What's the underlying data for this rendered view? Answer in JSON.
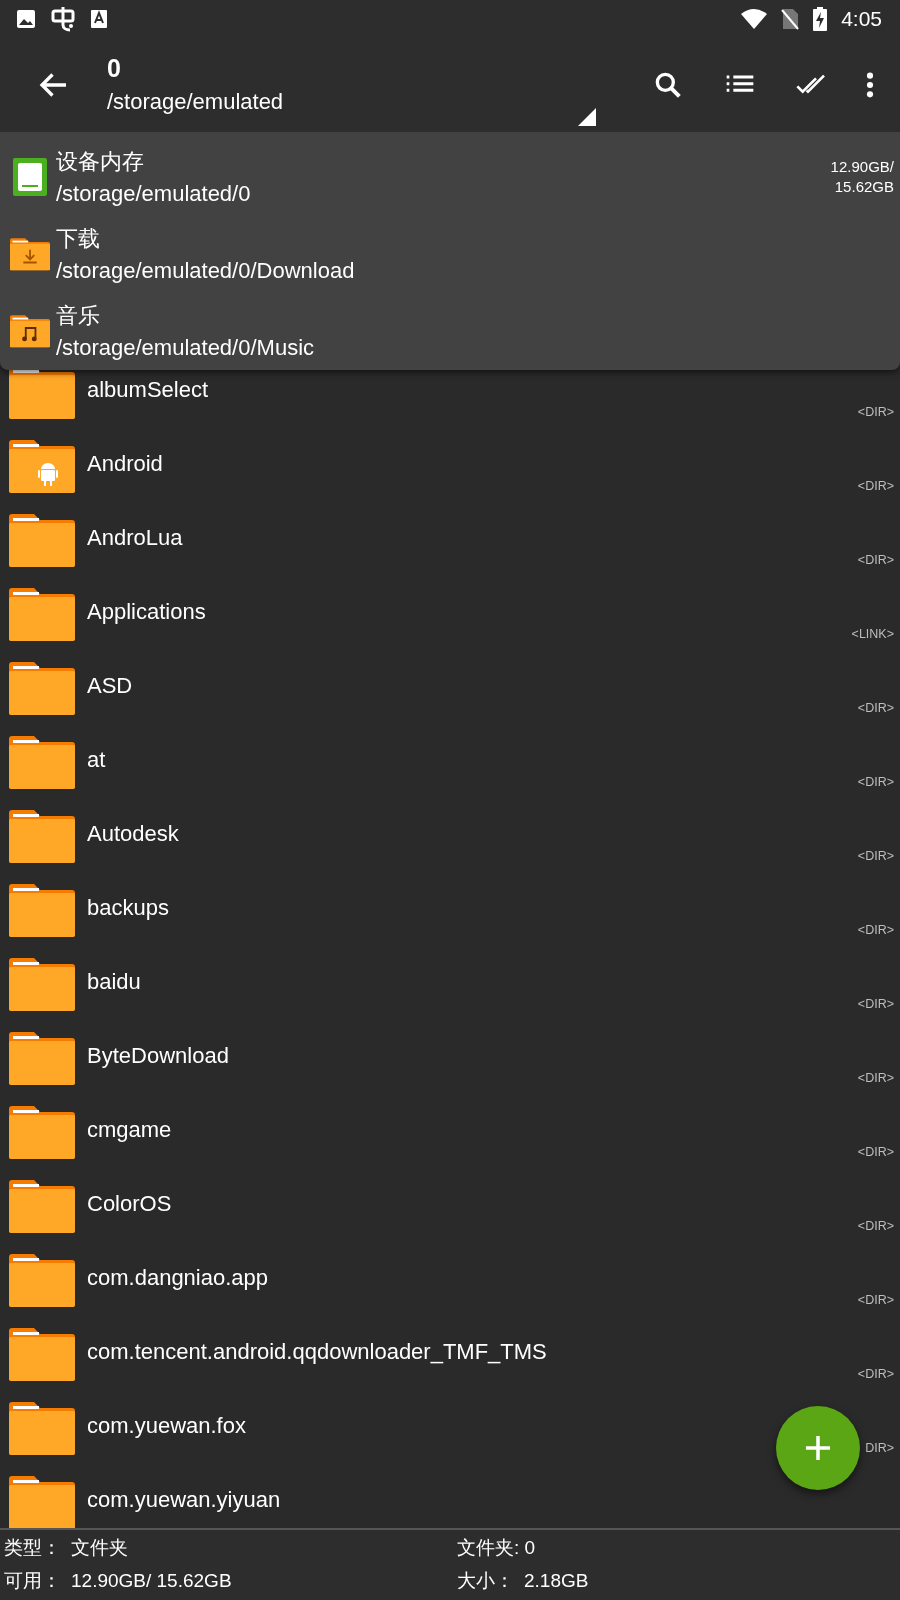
{
  "status_bar": {
    "time": "4:05"
  },
  "toolbar": {
    "title": "0",
    "path": "/storage/emulated"
  },
  "storage_menu": {
    "items": [
      {
        "kind": "storage",
        "name": "设备内存",
        "path": "/storage/emulated/0",
        "usage": [
          "12.90GB/",
          "15.62GB"
        ]
      },
      {
        "kind": "download",
        "name": "下载",
        "path": "/storage/emulated/0/Download"
      },
      {
        "kind": "music",
        "name": "音乐",
        "path": "/storage/emulated/0/Music"
      }
    ]
  },
  "files": [
    {
      "kind": "folder",
      "name": "albumSelect",
      "tag": "<DIR>"
    },
    {
      "kind": "android",
      "name": "Android",
      "tag": "<DIR>"
    },
    {
      "kind": "folder",
      "name": "AndroLua",
      "tag": "<DIR>"
    },
    {
      "kind": "folder",
      "name": "Applications",
      "tag": "<LINK>"
    },
    {
      "kind": "folder",
      "name": "ASD",
      "tag": "<DIR>"
    },
    {
      "kind": "folder",
      "name": "at",
      "tag": "<DIR>"
    },
    {
      "kind": "folder",
      "name": "Autodesk",
      "tag": "<DIR>"
    },
    {
      "kind": "folder",
      "name": "backups",
      "tag": "<DIR>"
    },
    {
      "kind": "folder",
      "name": "baidu",
      "tag": "<DIR>"
    },
    {
      "kind": "folder",
      "name": "ByteDownload",
      "tag": "<DIR>"
    },
    {
      "kind": "folder",
      "name": "cmgame",
      "tag": "<DIR>"
    },
    {
      "kind": "folder",
      "name": "ColorOS",
      "tag": "<DIR>"
    },
    {
      "kind": "folder",
      "name": "com.dangniao.app",
      "tag": "<DIR>"
    },
    {
      "kind": "folder",
      "name": "com.tencent.android.qqdownloader_TMF_TMS",
      "tag": "<DIR>"
    },
    {
      "kind": "folder",
      "name": "com.yuewan.fox",
      "tag": "DIR>"
    },
    {
      "kind": "folder",
      "name": "com.yuewan.yiyuan"
    }
  ],
  "footer": {
    "type_label": "类型：",
    "type_value": "文件夹",
    "free_label": "可用：",
    "free_value": "12.90GB/ 15.62GB",
    "folders": "文件夹: 0",
    "size_label": "大小：",
    "size_value": "2.18GB"
  }
}
